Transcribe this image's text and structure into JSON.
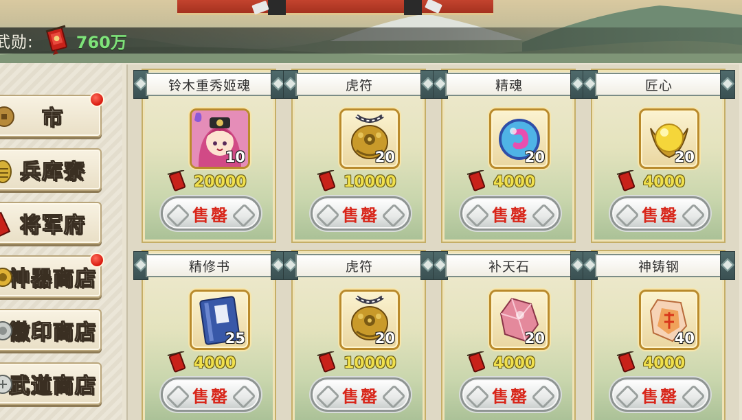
{
  "currency": {
    "label": "武勋:",
    "value": "760万"
  },
  "sidebar": {
    "items": [
      {
        "label": "市",
        "badge": true
      },
      {
        "label": "兵库寮",
        "badge": false
      },
      {
        "label": "将军府",
        "badge": false
      },
      {
        "label": "神器商店",
        "badge": true
      },
      {
        "label": "徽印商店",
        "badge": false
      },
      {
        "label": "武道商店",
        "badge": false
      }
    ]
  },
  "shop": {
    "items": [
      {
        "name": "铃木重秀姬魂",
        "qty": "10",
        "price": "20000",
        "button": "售罄",
        "icon": "character-portrait-icon"
      },
      {
        "name": "虎符",
        "qty": "20",
        "price": "10000",
        "button": "售罄",
        "icon": "tiger-tally-icon"
      },
      {
        "name": "精魂",
        "qty": "20",
        "price": "4000",
        "button": "售罄",
        "icon": "spirit-orb-icon"
      },
      {
        "name": "匠心",
        "qty": "20",
        "price": "4000",
        "button": "售罄",
        "icon": "golden-orb-icon"
      },
      {
        "name": "精修书",
        "qty": "25",
        "price": "4000",
        "button": "售罄",
        "icon": "blue-book-icon"
      },
      {
        "name": "虎符",
        "qty": "20",
        "price": "10000",
        "button": "售罄",
        "icon": "tiger-tally-icon"
      },
      {
        "name": "补天石",
        "qty": "20",
        "price": "4000",
        "button": "售罄",
        "icon": "crystal-stone-icon"
      },
      {
        "name": "神铸钢",
        "qty": "40",
        "price": "4000",
        "button": "售罄",
        "icon": "forged-steel-icon"
      }
    ]
  },
  "colors": {
    "currency_value": "#7fe37a",
    "price": "#f0e04c",
    "sold_out": "#d8261a",
    "badge": "#d8190e"
  }
}
